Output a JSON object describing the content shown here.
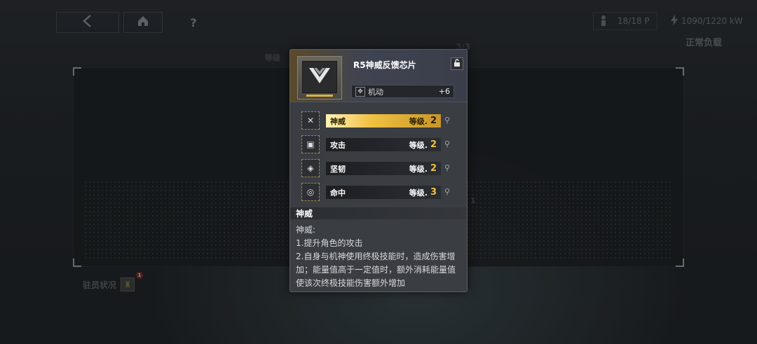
{
  "topbar": {
    "back_icon": "chevron-left-icon",
    "home_icon": "home-icon",
    "help_label": "?",
    "pilot_count": "18/18 P",
    "power": "1090/1220 kW",
    "load_state": "正常负载"
  },
  "background": {
    "level_label": "等级",
    "count_label": "3/3",
    "crew_status": "驻员状况",
    "crew_badge": "1",
    "side_number": "1"
  },
  "popup": {
    "title": "R5神威反馈芯片",
    "lock_icon": "unlock-icon",
    "stat": {
      "label": "机动",
      "value": "+6"
    },
    "skills": [
      {
        "name": "神威",
        "level_label": "等级.",
        "level": "2",
        "icon": "shenwei-icon",
        "active": true
      },
      {
        "name": "攻击",
        "level_label": "等级.",
        "level": "2",
        "icon": "attack-icon",
        "active": false
      },
      {
        "name": "坚韧",
        "level_label": "等级.",
        "level": "2",
        "icon": "toughness-icon",
        "active": false
      },
      {
        "name": "命中",
        "level_label": "等级.",
        "level": "3",
        "icon": "accuracy-icon",
        "active": false
      }
    ],
    "desc_title": "神威",
    "desc_lines": [
      "神威:",
      "1.提升角色的攻击",
      "2.自身与机神使用终极技能时，造成伤害增",
      "加；能量值高于一定值时，额外消耗能量值",
      "使该次终极技能伤害额外增加"
    ]
  },
  "colors": {
    "accent": "#f0c040",
    "panel": "#3a3d42"
  }
}
